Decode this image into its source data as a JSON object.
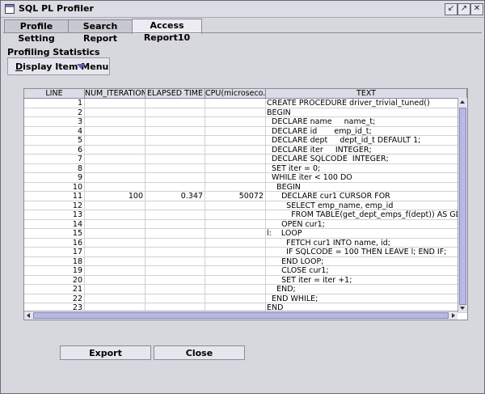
{
  "window": {
    "title": "SQL PL Profiler"
  },
  "tabs": [
    {
      "label": "Profile Setting"
    },
    {
      "label": "Search Report"
    },
    {
      "label": "Access Report10"
    }
  ],
  "section": {
    "title": "Profiling Statistics"
  },
  "menu_button": {
    "first": "D",
    "rest": "isplay Item Menu"
  },
  "table": {
    "columns": [
      "LINE",
      "NUM_ITERATION",
      "ELAPSED TIME",
      "CPU(microseco...",
      "TEXT"
    ],
    "rows": [
      [
        "1",
        "",
        "",
        "",
        "CREATE PROCEDURE driver_trivial_tuned()"
      ],
      [
        "2",
        "",
        "",
        "",
        "BEGIN"
      ],
      [
        "3",
        "",
        "",
        "",
        "  DECLARE name     name_t;"
      ],
      [
        "4",
        "",
        "",
        "",
        "  DECLARE id       emp_id_t;"
      ],
      [
        "5",
        "",
        "",
        "",
        "  DECLARE dept     dept_id_t DEFAULT 1;"
      ],
      [
        "6",
        "",
        "",
        "",
        "  DECLARE iter     INTEGER;"
      ],
      [
        "7",
        "",
        "",
        "",
        "  DECLARE SQLCODE  INTEGER;"
      ],
      [
        "8",
        "",
        "",
        "",
        "  SET iter = 0;"
      ],
      [
        "9",
        "",
        "",
        "",
        "  WHILE iter < 100 DO"
      ],
      [
        "10",
        "",
        "",
        "",
        "    BEGIN"
      ],
      [
        "11",
        "100",
        "0.347",
        "50072",
        "      DECLARE cur1 CURSOR FOR"
      ],
      [
        "12",
        "",
        "",
        "",
        "        SELECT emp_name, emp_id"
      ],
      [
        "13",
        "",
        "",
        "",
        "          FROM TABLE(get_dept_emps_f(dept)) AS GDE;"
      ],
      [
        "14",
        "",
        "",
        "",
        "      OPEN cur1;"
      ],
      [
        "15",
        "",
        "",
        "",
        "l:    LOOP"
      ],
      [
        "16",
        "",
        "",
        "",
        "        FETCH cur1 INTO name, id;"
      ],
      [
        "17",
        "",
        "",
        "",
        "        IF SQLCODE = 100 THEN LEAVE l; END IF;"
      ],
      [
        "18",
        "",
        "",
        "",
        "      END LOOP;"
      ],
      [
        "19",
        "",
        "",
        "",
        "      CLOSE cur1;"
      ],
      [
        "20",
        "",
        "",
        "",
        "      SET iter = iter +1;"
      ],
      [
        "21",
        "",
        "",
        "",
        "    END;"
      ],
      [
        "22",
        "",
        "",
        "",
        "  END WHILE;"
      ],
      [
        "23",
        "",
        "",
        "",
        "END"
      ]
    ]
  },
  "buttons": {
    "export": "Export",
    "close": "Close"
  },
  "icons": {
    "minimize": "↙",
    "maximize": "↗",
    "close": "✕"
  }
}
